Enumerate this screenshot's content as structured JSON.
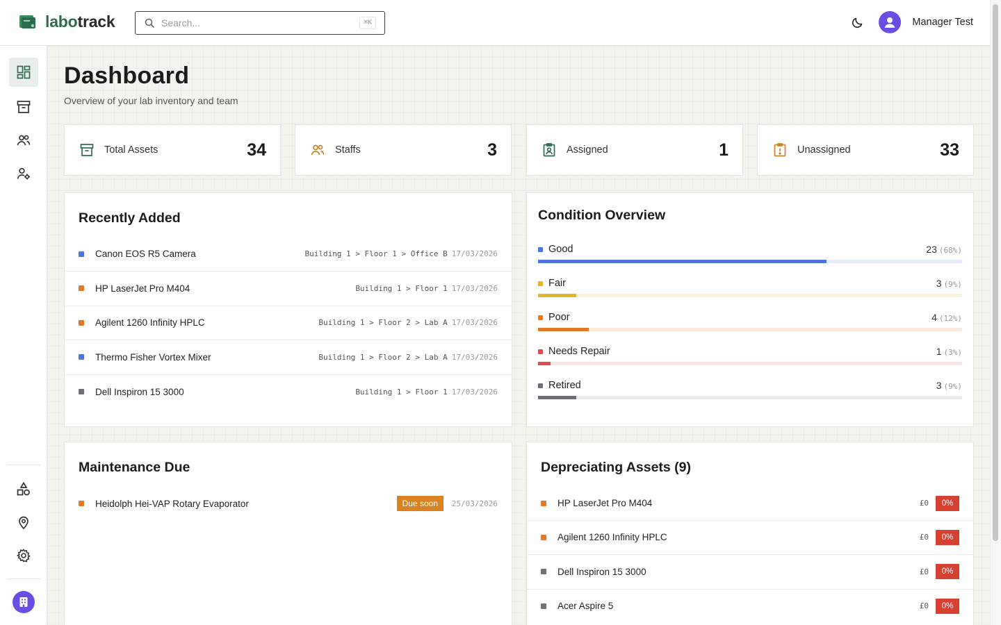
{
  "app": {
    "brand_prefix": "labo",
    "brand_suffix": "track",
    "brand_color": "#2f6b4f",
    "accent_purple": "#6b4de6"
  },
  "search": {
    "placeholder": "Search...",
    "shortcut": "⌘K"
  },
  "user": {
    "name": "Manager Test"
  },
  "sidebar": {
    "top_items": [
      {
        "icon": "dashboard-icon",
        "active": true
      },
      {
        "icon": "archive-box-icon",
        "active": false
      },
      {
        "icon": "users-icon",
        "active": false
      },
      {
        "icon": "user-settings-icon",
        "active": false
      }
    ],
    "bottom_items": [
      {
        "icon": "shapes-icon"
      },
      {
        "icon": "location-pin-icon"
      },
      {
        "icon": "gear-icon"
      }
    ],
    "org_avatar_icon": "building-icon"
  },
  "page": {
    "title": "Dashboard",
    "subtitle": "Overview of your lab inventory and team"
  },
  "stats": [
    {
      "label": "Total Assets",
      "value": "34",
      "icon": "archive-box-icon",
      "color": "#2f6b4f"
    },
    {
      "label": "Staffs",
      "value": "3",
      "icon": "users-icon",
      "color": "#c8822a"
    },
    {
      "label": "Assigned",
      "value": "1",
      "icon": "clipboard-user-icon",
      "color": "#2f6b4f"
    },
    {
      "label": "Unassigned",
      "value": "33",
      "icon": "clipboard-alert-icon",
      "color": "#c8822a"
    }
  ],
  "recent": {
    "title": "Recently Added",
    "items": [
      {
        "name": "Canon EOS R5 Camera",
        "location": "Building 1 > Floor 1 > Office B",
        "date": "17/03/2026",
        "color": "#4f74e0"
      },
      {
        "name": "HP LaserJet Pro M404",
        "location": "Building 1 > Floor 1",
        "date": "17/03/2026",
        "color": "#e07a26"
      },
      {
        "name": "Agilent 1260 Infinity HPLC",
        "location": "Building 1 > Floor 2 > Lab A",
        "date": "17/03/2026",
        "color": "#e07a26"
      },
      {
        "name": "Thermo Fisher Vortex Mixer",
        "location": "Building 1 > Floor 2 > Lab A",
        "date": "17/03/2026",
        "color": "#4f74e0"
      },
      {
        "name": "Dell Inspiron 15 3000",
        "location": "Building 1 > Floor 1",
        "date": "17/03/2026",
        "color": "#6e6e76"
      }
    ]
  },
  "condition": {
    "title": "Condition Overview",
    "items": [
      {
        "label": "Good",
        "count": "23",
        "pct": "(68%)",
        "ratio": 0.68,
        "color": "#4f74e0",
        "track": "#e8edfb"
      },
      {
        "label": "Fair",
        "count": "3",
        "pct": "(9%)",
        "ratio": 0.09,
        "color": "#e3b52a",
        "track": "#fbf3dc"
      },
      {
        "label": "Poor",
        "count": "4",
        "pct": "(12%)",
        "ratio": 0.12,
        "color": "#e07a26",
        "track": "#fbeadb"
      },
      {
        "label": "Needs Repair",
        "count": "1",
        "pct": "(3%)",
        "ratio": 0.03,
        "color": "#dc4a4a",
        "track": "#fbe4e4"
      },
      {
        "label": "Retired",
        "count": "3",
        "pct": "(9%)",
        "ratio": 0.09,
        "color": "#6e6e76",
        "track": "#ebebeb"
      }
    ]
  },
  "maintenance": {
    "title": "Maintenance Due",
    "items": [
      {
        "name": "Heidolph Hei-VAP Rotary Evaporator",
        "badge": "Due soon",
        "date": "25/03/2026",
        "color": "#e07a26"
      }
    ]
  },
  "depreciating": {
    "title": "Depreciating Assets (9)",
    "items": [
      {
        "name": "HP LaserJet Pro M404",
        "price": "£0",
        "pct": "0%",
        "color": "#e07a26"
      },
      {
        "name": "Agilent 1260 Infinity HPLC",
        "price": "£0",
        "pct": "0%",
        "color": "#e07a26"
      },
      {
        "name": "Dell Inspiron 15 3000",
        "price": "£0",
        "pct": "0%",
        "color": "#6e6e76"
      },
      {
        "name": "Acer Aspire 5",
        "price": "£0",
        "pct": "0%",
        "color": "#6e6e76"
      }
    ]
  }
}
